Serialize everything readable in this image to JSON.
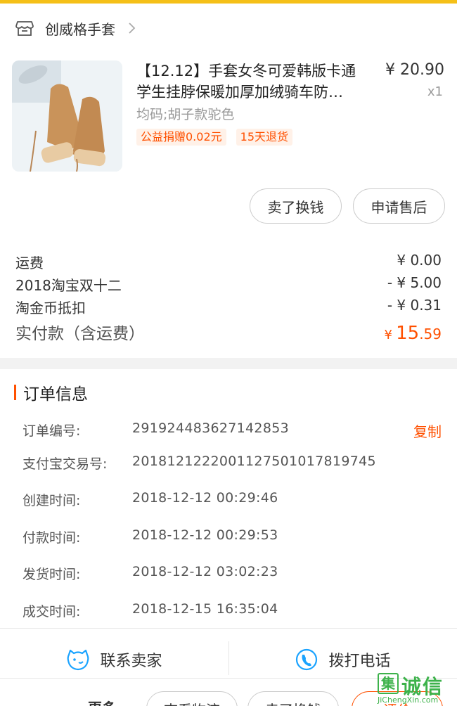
{
  "colors": {
    "accent": "#ff5000",
    "topbar": "#f5c018",
    "icon_blue": "#1aa3ff"
  },
  "shop": {
    "name": "创威格手套",
    "icon": "store-icon"
  },
  "product": {
    "title_line1": "【12.12】手套女冬可爱韩版卡通",
    "title_line2": "学生挂脖保暖加厚加绒骑车防…",
    "price": "¥ 20.90",
    "quantity": "x1",
    "sku": "均码;胡子款驼色",
    "tags": [
      "公益捐赠0.02元",
      "15天退货"
    ],
    "image": "glove-product-image"
  },
  "item_actions": {
    "sell": "卖了换钱",
    "after_sale": "申请售后"
  },
  "fees": [
    {
      "label": "运费",
      "value": "¥ 0.00"
    },
    {
      "label": "2018淘宝双十二",
      "value": "- ¥ 5.00"
    },
    {
      "label": "淘金币抵扣",
      "value": "- ¥ 0.31"
    }
  ],
  "payment": {
    "label": "实付款（含运费）",
    "currency": "¥",
    "integer": "15",
    "decimal": ".59"
  },
  "order_info": {
    "title": "订单信息",
    "copy_label": "复制",
    "rows": [
      {
        "label": "订单编号:",
        "value": "291924483627142853"
      },
      {
        "label": "支付宝交易号:",
        "value": "2018121222001127501017819745"
      },
      {
        "label": "创建时间:",
        "value": "2018-12-12 00:29:46"
      },
      {
        "label": "付款时间:",
        "value": "2018-12-12 00:29:53"
      },
      {
        "label": "发货时间:",
        "value": "2018-12-12 03:02:23"
      },
      {
        "label": "成交时间:",
        "value": "2018-12-15 16:35:04"
      }
    ]
  },
  "contact": {
    "seller": "联系卖家",
    "phone": "拨打电话"
  },
  "bottom_bar": {
    "more": "更多",
    "logistics": "查看物流",
    "sell": "卖了换钱",
    "third": "评价"
  },
  "watermark": {
    "box": "集",
    "text": "诚信",
    "sub": "JiChengXin.com"
  }
}
